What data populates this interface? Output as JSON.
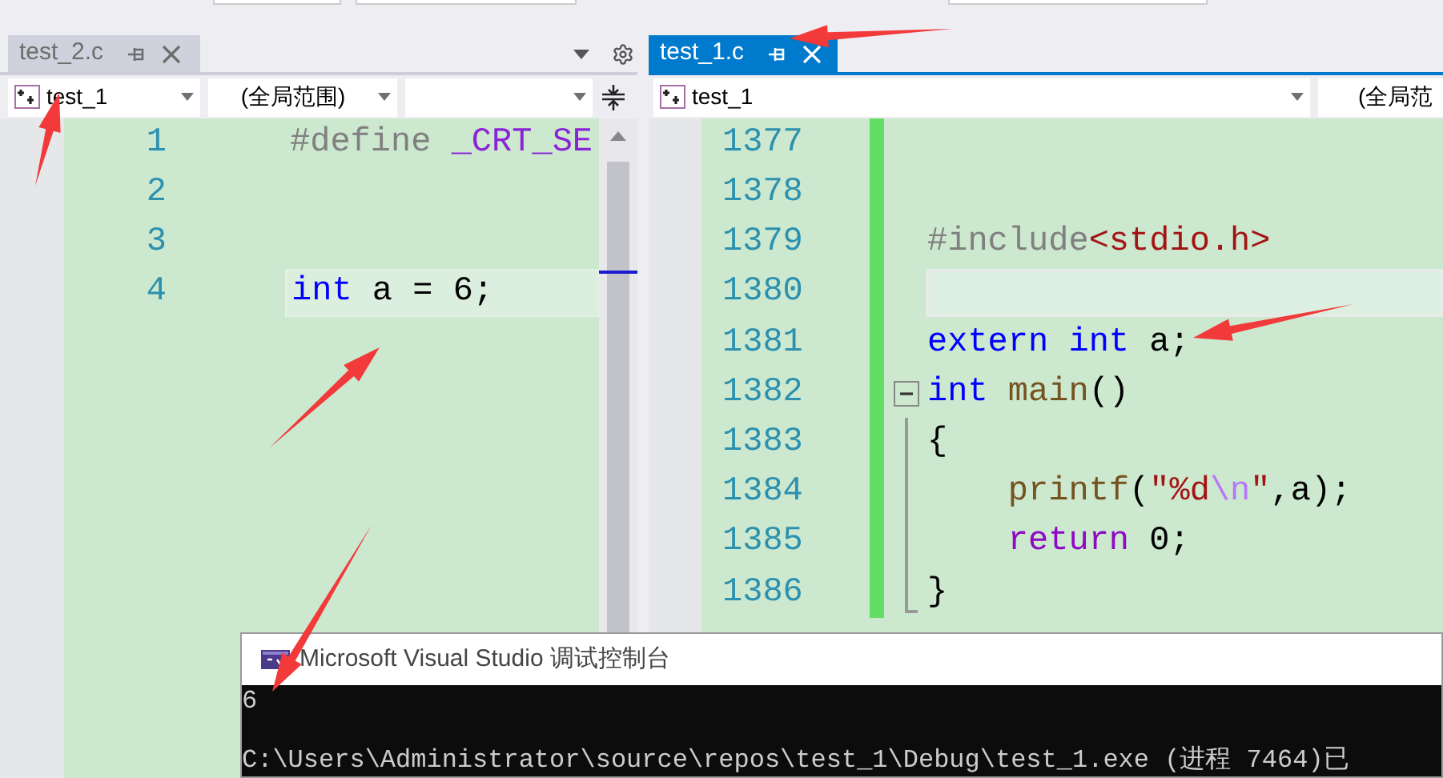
{
  "left_pane": {
    "tab": {
      "label": "test_2.c",
      "selected": false
    },
    "navigation": {
      "project": "test_1",
      "scope": "(全局范围)"
    },
    "lines": [
      {
        "number": "1",
        "current": false,
        "tokens": [
          {
            "kind": "preproc",
            "text": "#define"
          },
          {
            "kind": "macro",
            "text": " _CRT_SE"
          }
        ]
      },
      {
        "number": "2",
        "current": false
      },
      {
        "number": "3",
        "current": false
      },
      {
        "number": "4",
        "current": true,
        "tokens": [
          {
            "kind": "keyword",
            "text": "int"
          },
          {
            "kind": "plain",
            "text": " a = 6;"
          }
        ]
      }
    ]
  },
  "right_pane": {
    "tab": {
      "label": "test_1.c",
      "selected": true
    },
    "navigation": {
      "project": "test_1",
      "scope": "(全局范"
    },
    "lines": [
      {
        "number": "1377",
        "current": false,
        "kind": "plain"
      },
      {
        "number": "1378",
        "current": false,
        "kind": "plain"
      },
      {
        "number": "1379",
        "current": false,
        "kind": "plain",
        "tokens": [
          {
            "kind": "preproc",
            "text": "#include"
          },
          {
            "kind": "string",
            "text": "<stdio.h>"
          }
        ]
      },
      {
        "number": "1380",
        "current": true,
        "kind": "plain"
      },
      {
        "number": "1381",
        "current": false,
        "kind": "plain",
        "tokens": [
          {
            "kind": "keyword",
            "text": "extern"
          },
          {
            "kind": "keyword",
            "text": " int"
          },
          {
            "kind": "plain",
            "text": " a;"
          }
        ]
      },
      {
        "number": "1382",
        "current": false,
        "kind": "fold_start",
        "tokens": [
          {
            "kind": "keyword",
            "text": "int"
          },
          {
            "kind": "function",
            "text": " main"
          },
          {
            "kind": "plain",
            "text": "()"
          }
        ]
      },
      {
        "number": "1383",
        "current": false,
        "kind": "fold_body",
        "tokens": [
          {
            "kind": "plain",
            "text": "{"
          }
        ]
      },
      {
        "number": "1384",
        "current": false,
        "kind": "fold_body",
        "tokens": [
          {
            "kind": "function",
            "text": "    printf"
          },
          {
            "kind": "plain",
            "text": "("
          },
          {
            "kind": "string",
            "text": "\"%d"
          },
          {
            "kind": "escape",
            "text": "\\n"
          },
          {
            "kind": "string",
            "text": "\""
          },
          {
            "kind": "plain",
            "text": ",a);"
          }
        ]
      },
      {
        "number": "1385",
        "current": false,
        "kind": "fold_body",
        "tokens": [
          {
            "kind": "control",
            "text": "    return"
          },
          {
            "kind": "plain",
            "text": " 0;"
          }
        ]
      },
      {
        "number": "1386",
        "current": false,
        "kind": "fold_end",
        "tokens": [
          {
            "kind": "plain",
            "text": "}"
          }
        ]
      }
    ]
  },
  "console": {
    "title": "Microsoft Visual Studio 调试控制台",
    "output": [
      "6",
      "C:\\Users\\Administrator\\source\\repos\\test_1\\Debug\\test_1.exe (进程 7464)已"
    ]
  }
}
